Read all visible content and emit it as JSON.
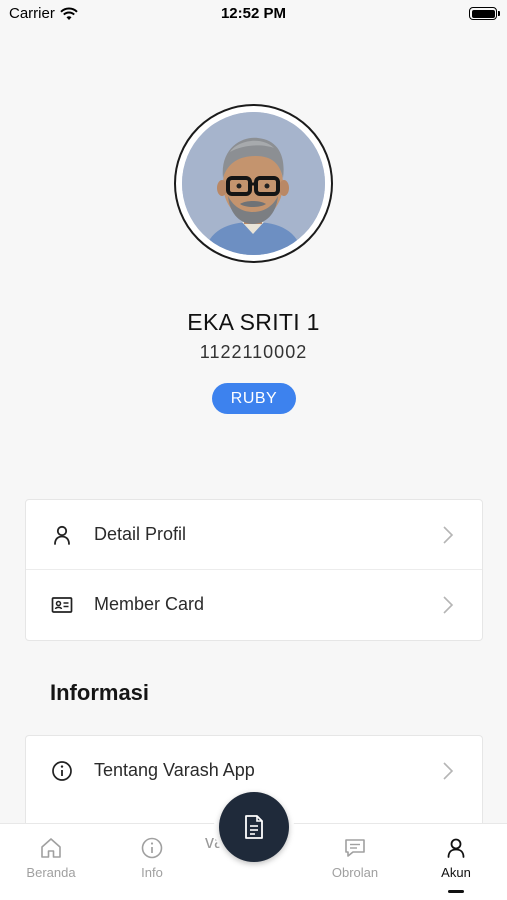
{
  "status_bar": {
    "carrier": "Carrier",
    "time": "12:52 PM"
  },
  "profile": {
    "name": "EKA SRITI 1",
    "member_id": "1122110002",
    "tier": "RUBY"
  },
  "account_menu": [
    {
      "label": "Detail Profil",
      "icon": "user-icon"
    },
    {
      "label": "Member Card",
      "icon": "id-card-icon"
    }
  ],
  "info_section": {
    "title": "Informasi",
    "items": [
      {
        "label": "Tentang Varash App",
        "icon": "info-icon"
      }
    ],
    "partial_text": "va"
  },
  "tabbar": {
    "tabs": [
      {
        "label": "Beranda",
        "icon": "home-icon"
      },
      {
        "label": "Info",
        "icon": "info-icon"
      },
      {
        "label": "Obrolan",
        "icon": "chat-icon"
      },
      {
        "label": "Akun",
        "icon": "user-icon",
        "active": true
      }
    ],
    "center_button_icon": "document-icon"
  },
  "colors": {
    "accent": "#3d82ee",
    "fab": "#1f2a3a",
    "background": "#f7f7f7"
  }
}
